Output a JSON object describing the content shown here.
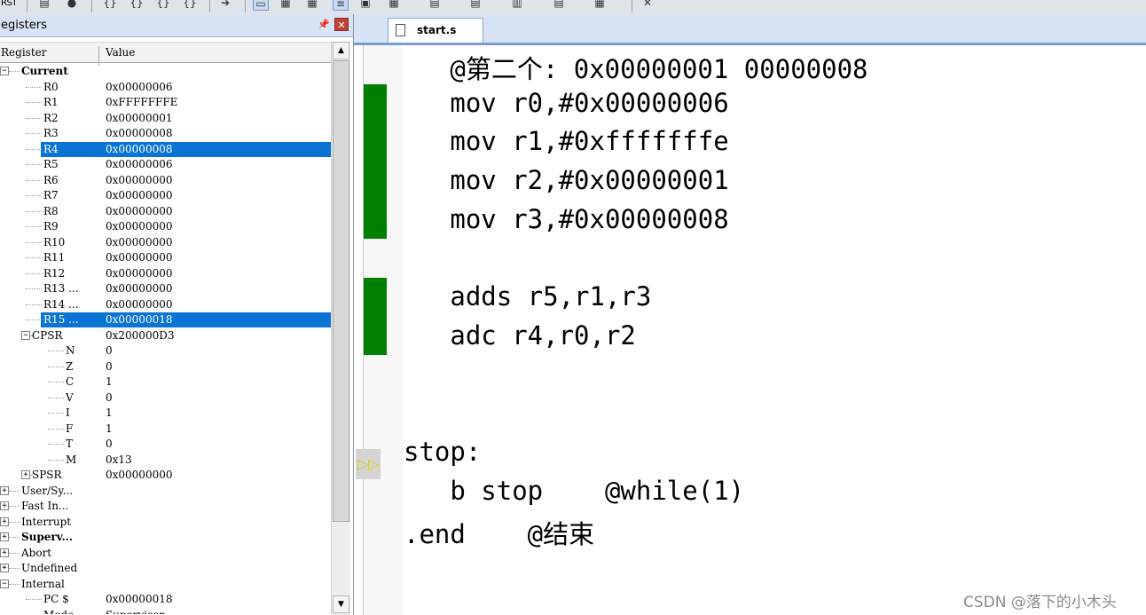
{
  "toolbar": {
    "rst_label": "RST",
    "icons": [
      "reset-icon",
      "run-icon",
      "step-into-icon",
      "step-over-icon",
      "step-out-icon",
      "run-to-cursor-icon",
      "show-next-statement-icon",
      "command-window-icon",
      "disassembly-window-icon",
      "symbols-window-icon",
      "registers-window-icon",
      "call-stack-icon",
      "watch-window-icon",
      "memory-window-icon",
      "serial-window-icon",
      "analysis-window-icon",
      "trace-window-icon",
      "system-viewer-icon",
      "toolbox-icon",
      "debug-settings-icon"
    ]
  },
  "registers_panel": {
    "title": "egisters",
    "pin_icon": "pin-icon",
    "close_icon": "close-icon",
    "col_register": "Register",
    "col_value": "Value",
    "rows": [
      {
        "name": "Current",
        "value": "",
        "level": 0,
        "expander": "-",
        "bold": true
      },
      {
        "name": "R0",
        "value": "0x00000006",
        "level": 2
      },
      {
        "name": "R1",
        "value": "0xFFFFFFFE",
        "level": 2
      },
      {
        "name": "R2",
        "value": "0x00000001",
        "level": 2
      },
      {
        "name": "R3",
        "value": "0x00000008",
        "level": 2
      },
      {
        "name": "R4",
        "value": "0x00000008",
        "level": 2,
        "selected": true
      },
      {
        "name": "R5",
        "value": "0x00000006",
        "level": 2
      },
      {
        "name": "R6",
        "value": "0x00000000",
        "level": 2
      },
      {
        "name": "R7",
        "value": "0x00000000",
        "level": 2
      },
      {
        "name": "R8",
        "value": "0x00000000",
        "level": 2
      },
      {
        "name": "R9",
        "value": "0x00000000",
        "level": 2
      },
      {
        "name": "R10",
        "value": "0x00000000",
        "level": 2
      },
      {
        "name": "R11",
        "value": "0x00000000",
        "level": 2
      },
      {
        "name": "R12",
        "value": "0x00000000",
        "level": 2
      },
      {
        "name": "R13 ...",
        "value": "0x00000000",
        "level": 2
      },
      {
        "name": "R14 ...",
        "value": "0x00000000",
        "level": 2
      },
      {
        "name": "R15 ...",
        "value": "0x00000018",
        "level": 2,
        "selected": true
      },
      {
        "name": "CPSR",
        "value": "0x200000D3",
        "level": 1,
        "expander": "-"
      },
      {
        "name": "N",
        "value": "0",
        "level": 3
      },
      {
        "name": "Z",
        "value": "0",
        "level": 3
      },
      {
        "name": "C",
        "value": "1",
        "level": 3
      },
      {
        "name": "V",
        "value": "0",
        "level": 3
      },
      {
        "name": "I",
        "value": "1",
        "level": 3
      },
      {
        "name": "F",
        "value": "1",
        "level": 3
      },
      {
        "name": "T",
        "value": "0",
        "level": 3
      },
      {
        "name": "M",
        "value": "0x13",
        "level": 3
      },
      {
        "name": "SPSR",
        "value": "0x00000000",
        "level": 1,
        "expander": "+"
      },
      {
        "name": "User/Sy...",
        "value": "",
        "level": 0,
        "expander": "+"
      },
      {
        "name": "Fast In...",
        "value": "",
        "level": 0,
        "expander": "+"
      },
      {
        "name": "Interrupt",
        "value": "",
        "level": 0,
        "expander": "+"
      },
      {
        "name": "Superv...",
        "value": "",
        "level": 0,
        "expander": "+",
        "bold": true
      },
      {
        "name": "Abort",
        "value": "",
        "level": 0,
        "expander": "+"
      },
      {
        "name": "Undefined",
        "value": "",
        "level": 0,
        "expander": "+"
      },
      {
        "name": "Internal",
        "value": "",
        "level": 0,
        "expander": "-"
      },
      {
        "name": "PC  $",
        "value": "0x00000018",
        "level": 2
      },
      {
        "name": "Mode",
        "value": "Supervisor",
        "level": 2
      }
    ]
  },
  "editor": {
    "tab_label": "start.s",
    "file_icon": "file-icon",
    "execution_marker_icon": "current-execution-arrow-icon",
    "lines": [
      "   @第二个: 0x00000001 00000008",
      "   mov r0,#0x00000006",
      "   mov r1,#0xfffffffe",
      "   mov r2,#0x00000001",
      "   mov r3,#0x00000008",
      "",
      "   adds r5,r1,r3",
      "   adc r4,r0,r2",
      "",
      "",
      "stop:",
      "   b stop    @while(1)",
      ".end    @结束"
    ]
  },
  "colors": {
    "selection": "#0a74d4",
    "executed_marker": "#008000",
    "panel_header": "#d7e4f5"
  },
  "watermark": "CSDN @落下的小木头"
}
